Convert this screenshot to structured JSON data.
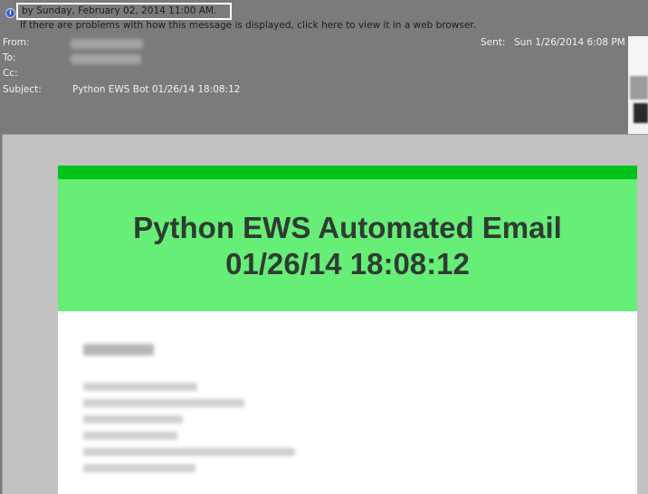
{
  "header": {
    "followup_text": "by Sunday, February 02, 2014 11:00 AM.",
    "browser_hint": "If there are problems with how this message is displayed, click here to view it in a web browser.",
    "from_label": "From:",
    "to_label": "To:",
    "cc_label": "Cc:",
    "subject_label": "Subject:",
    "subject_value": "Python EWS Bot 01/26/14 18:08:12",
    "sent_label": "Sent:",
    "sent_value": "Sun 1/26/2014 6:08 PM",
    "icons": [
      "info-icon",
      "contact-picture"
    ]
  },
  "email": {
    "banner_line1": "Python EWS Automated Email",
    "banner_line2": "01/26/14 18:08:12"
  },
  "colors": {
    "header_bg": "#7b7b7b",
    "pane_bg": "#c2c2c2",
    "top_bar_green": "#00c41a",
    "banner_green": "#66ee77",
    "banner_text": "#2f3b33"
  }
}
